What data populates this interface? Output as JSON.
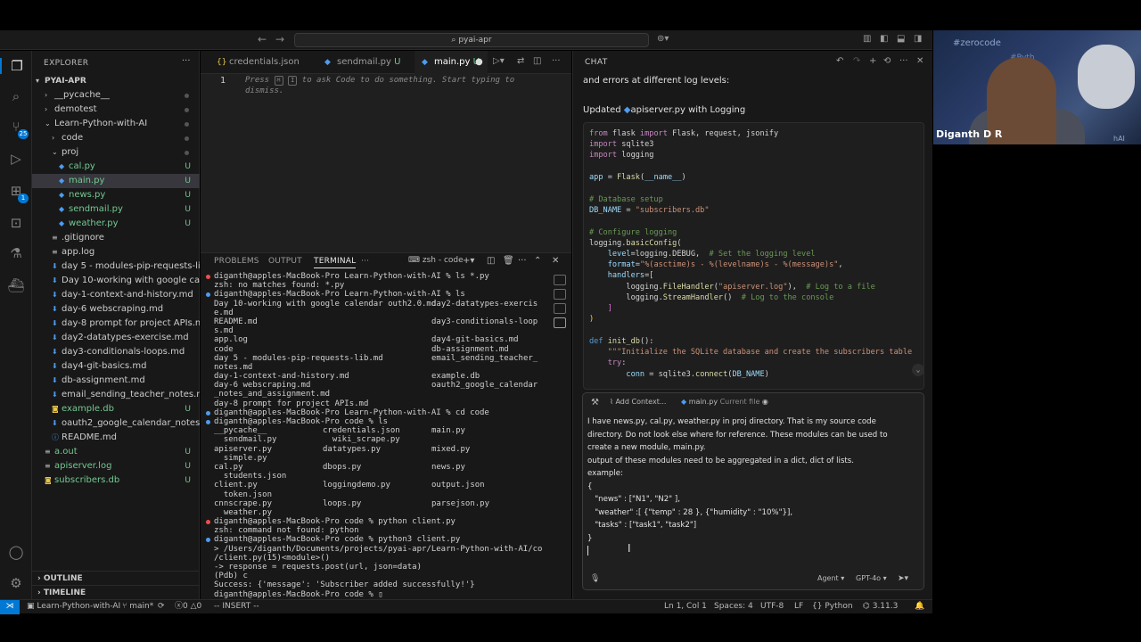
{
  "titlebar": {
    "command_center": "pyai-apr",
    "back_glyph": "←",
    "forward_glyph": "→"
  },
  "explorer": {
    "title": "EXPLORER",
    "root": "PYAI-APR",
    "items": [
      {
        "label": "__pycache__",
        "depth": 1,
        "kind": "folder",
        "status": ""
      },
      {
        "label": "demotest",
        "depth": 1,
        "kind": "folder",
        "status": ""
      },
      {
        "label": "Learn-Python-with-AI",
        "depth": 1,
        "kind": "folder-open",
        "status": ""
      },
      {
        "label": "code",
        "depth": 2,
        "kind": "folder",
        "status": ""
      },
      {
        "label": "proj",
        "depth": 2,
        "kind": "folder-open",
        "status": ""
      },
      {
        "label": "cal.py",
        "depth": 3,
        "kind": "py",
        "status": "U"
      },
      {
        "label": "main.py",
        "depth": 3,
        "kind": "py",
        "status": "U"
      },
      {
        "label": "news.py",
        "depth": 3,
        "kind": "py",
        "status": "U"
      },
      {
        "label": "sendmail.py",
        "depth": 3,
        "kind": "py",
        "status": "U"
      },
      {
        "label": "weather.py",
        "depth": 3,
        "kind": "py",
        "status": "U"
      },
      {
        "label": ".gitignore",
        "depth": 2,
        "kind": "file",
        "status": ""
      },
      {
        "label": "app.log",
        "depth": 2,
        "kind": "log",
        "status": ""
      },
      {
        "label": "day 5 - modules-pip-requests-lib....",
        "depth": 2,
        "kind": "md",
        "status": ""
      },
      {
        "label": "Day 10-working with google calen...",
        "depth": 2,
        "kind": "md",
        "status": ""
      },
      {
        "label": "day-1-context-and-history.md",
        "depth": 2,
        "kind": "md",
        "status": ""
      },
      {
        "label": "day-6 webscraping.md",
        "depth": 2,
        "kind": "md",
        "status": ""
      },
      {
        "label": "day-8 prompt for project APIs.md",
        "depth": 2,
        "kind": "md",
        "status": ""
      },
      {
        "label": "day2-datatypes-exercise.md",
        "depth": 2,
        "kind": "md",
        "status": ""
      },
      {
        "label": "day3-conditionals-loops.md",
        "depth": 2,
        "kind": "md",
        "status": ""
      },
      {
        "label": "day4-git-basics.md",
        "depth": 2,
        "kind": "md",
        "status": ""
      },
      {
        "label": "db-assignment.md",
        "depth": 2,
        "kind": "md",
        "status": ""
      },
      {
        "label": "email_sending_teacher_notes.md",
        "depth": 2,
        "kind": "md",
        "status": ""
      },
      {
        "label": "example.db",
        "depth": 2,
        "kind": "db",
        "status": "U"
      },
      {
        "label": "oauth2_google_calendar_notes_a...",
        "depth": 2,
        "kind": "md",
        "status": ""
      },
      {
        "label": "README.md",
        "depth": 2,
        "kind": "info",
        "status": ""
      },
      {
        "label": "a.out",
        "depth": 1,
        "kind": "file",
        "status": "U"
      },
      {
        "label": "apiserver.log",
        "depth": 1,
        "kind": "log",
        "status": "U"
      },
      {
        "label": "subscribers.db",
        "depth": 1,
        "kind": "db",
        "status": "U"
      }
    ],
    "outline": "OUTLINE",
    "timeline": "TIMELINE"
  },
  "editor": {
    "tabs": [
      {
        "label": "credentials.json",
        "status": ""
      },
      {
        "label": "sendmail.py",
        "status": "U"
      },
      {
        "label": "main.py",
        "status": "U"
      }
    ],
    "line_number": "1",
    "hint_before": "Press",
    "hint_k1": "⌘",
    "hint_k2": "I",
    "hint_after": "to ask Code to do something. Start typing to",
    "hint_line2": "dismiss."
  },
  "panel": {
    "tabs": [
      "PROBLEMS",
      "OUTPUT",
      "TERMINAL"
    ],
    "more": "···",
    "shell": "zsh - code",
    "lines": [
      {
        "bullet": "err",
        "text": "diganth@apples-MacBook-Pro Learn-Python-with-AI % ls *.py"
      },
      {
        "bullet": "",
        "text": "zsh: no matches found: *.py"
      },
      {
        "bullet": "ok",
        "text": "diganth@apples-MacBook-Pro Learn-Python-with-AI % ls"
      },
      {
        "bullet": "",
        "text": "Day 10-working with google calendar outh2.0.md",
        "c2": "day2-datatypes-exercis"
      },
      {
        "bullet": "",
        "text": "e.md"
      },
      {
        "bullet": "",
        "text": "README.md",
        "c2": "day3-conditionals-loop"
      },
      {
        "bullet": "",
        "text": "s.md"
      },
      {
        "bullet": "",
        "text": "app.log",
        "c2": "day4-git-basics.md"
      },
      {
        "bullet": "",
        "text": "code",
        "c2": "db-assignment.md"
      },
      {
        "bullet": "",
        "text": "day 5 - modules-pip-requests-lib.md",
        "c2": "email_sending_teacher_"
      },
      {
        "bullet": "",
        "text": "notes.md"
      },
      {
        "bullet": "",
        "text": "day-1-context-and-history.md",
        "c2": "example.db"
      },
      {
        "bullet": "",
        "text": "day-6 webscraping.md",
        "c2": "oauth2_google_calendar"
      },
      {
        "bullet": "",
        "text": "_notes_and_assignment.md"
      },
      {
        "bullet": "",
        "text": "day-8 prompt for project APIs.md"
      },
      {
        "bullet": "ok",
        "text": "diganth@apples-MacBook-Pro Learn-Python-with-AI % cd code"
      },
      {
        "bullet": "ok",
        "text": "diganth@apples-MacBook-Pro code % ls"
      },
      {
        "bullet": "",
        "text": "__pycache__",
        "c1b": "credentials.json",
        "c2": "main.py"
      },
      {
        "bullet": "",
        "text": "  sendmail.py",
        "c1b": "  wiki_scrape.py"
      },
      {
        "bullet": "",
        "text": "apiserver.py",
        "c1b": "datatypes.py",
        "c2": "mixed.py"
      },
      {
        "bullet": "",
        "text": "  simple.py"
      },
      {
        "bullet": "",
        "text": "cal.py",
        "c1b": "dbops.py",
        "c2": "news.py"
      },
      {
        "bullet": "",
        "text": "  students.json"
      },
      {
        "bullet": "",
        "text": "client.py",
        "c1b": "loggingdemo.py",
        "c2": "output.json"
      },
      {
        "bullet": "",
        "text": "  token.json"
      },
      {
        "bullet": "",
        "text": "cnnscrape.py",
        "c1b": "loops.py",
        "c2": "parsejson.py"
      },
      {
        "bullet": "",
        "text": "  weather.py"
      },
      {
        "bullet": "err",
        "text": "diganth@apples-MacBook-Pro code % python client.py"
      },
      {
        "bullet": "",
        "text": "zsh: command not found: python"
      },
      {
        "bullet": "ok",
        "text": "diganth@apples-MacBook-Pro code % python3 client.py"
      },
      {
        "bullet": "",
        "text": "> /Users/diganth/Documents/projects/pyai-apr/Learn-Python-with-AI/code"
      },
      {
        "bullet": "",
        "text": "/client.py(15)<module>()"
      },
      {
        "bullet": "",
        "text": "-> response = requests.post(url, json=data)"
      },
      {
        "bullet": "",
        "text": "(Pdb) c"
      },
      {
        "bullet": "",
        "text": "Success: {'message': 'Subscriber added successfully!'}"
      },
      {
        "bullet": "",
        "text": "diganth@apples-MacBook-Pro code % ▯"
      }
    ]
  },
  "chat": {
    "title": "CHAT",
    "prev_text": "and errors at different log levels:",
    "updated_label": "Updated",
    "updated_file": "apiserver.py",
    "updated_suffix": "with Logging",
    "add_context": "Add Context...",
    "current_file": "main.py",
    "current_file_tag": "Current file",
    "prompt_text": "I have news.py, cal.py, weather.py in proj directory. That is my source code\ndirectory. Do not look else where for reference. These modules can be used to\ncreate a new module, main.py.\noutput of these modules need to be aggregated in a dict, dict of lists.\nexample:\n{\n   \"news\" : [\"N1\", \"N2\" ],\n   \"weather\" :[ {\"temp\" : 28 }, {\"humidity\" : \"10%\"}],\n   \"tasks\" : [\"task1\", \"task2\"]\n}",
    "mode": "Agent",
    "model": "GPT-4o"
  },
  "statusbar": {
    "branch": "Learn-Python-with-AI",
    "git": "main*",
    "errors": "0",
    "warnings": "0",
    "vim_mode": "-- INSERT --",
    "position": "Ln 1, Col 1",
    "spaces": "Spaces: 4",
    "encoding": "UTF-8",
    "eol": "LF",
    "language": "Python",
    "python_version": "3.11.3"
  },
  "webcam": {
    "watermark": "#zerocode",
    "watermark2": "#Pyth",
    "presenter": "Diganth D R",
    "suffix": "hAI"
  },
  "colors": {
    "accent": "#0078d4",
    "untracked": "#73c991",
    "error_dot": "#f14c4c",
    "ok_dot": "#4d9cf0"
  }
}
